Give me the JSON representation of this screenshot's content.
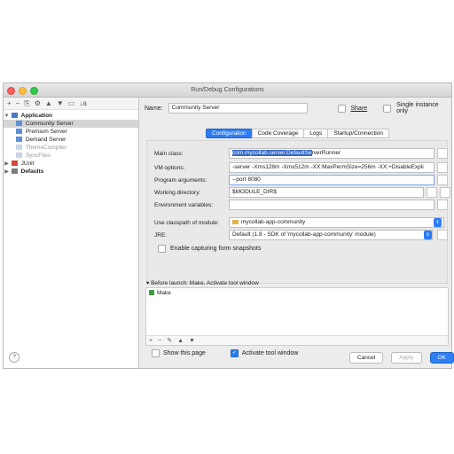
{
  "window": {
    "title": "Run/Debug Configurations"
  },
  "left_toolbar": {
    "add": "+",
    "remove": "−",
    "copy": "⎘",
    "settings": "⚙",
    "up": "▲",
    "down": "▼",
    "folder": "▭",
    "sort": "↓a"
  },
  "tree": {
    "application": "Application",
    "items": [
      "Community Server",
      "Premium Server",
      "Demand Server",
      "ThemeCompiler",
      "SyncFiles"
    ],
    "junit": "JUnit",
    "defaults": "Defaults"
  },
  "name_row": {
    "label": "Name:",
    "value": "Community Server",
    "share": "Share",
    "single": "Single instance only"
  },
  "tabs": [
    "Configuration",
    "Code Coverage",
    "Logs",
    "Startup/Connection"
  ],
  "form": {
    "main_class_label": "Main class:",
    "main_class_prefix": "com.mycollab.server.DefaultSe",
    "main_class_suffix": "rverRunner",
    "vm_label": "VM options:",
    "vm_value": "-server -Xms128m -Xmx512m -XX:MaxPermSize=256m -XX:+DisableExpli",
    "prog_label": "Program arguments:",
    "prog_value": "--port 8080",
    "wd_label": "Working directory:",
    "wd_value": "$MODULE_DIR$",
    "env_label": "Environment variables:",
    "env_value": "",
    "cp_label": "Use classpath of module:",
    "cp_value": "mycollab-app-community",
    "jre_label": "JRE:",
    "jre_value": "Default (1.8 - SDK of 'mycollab-app-community' module)",
    "snap_label": "Enable capturing form snapshots"
  },
  "before": {
    "title": "▾ Before launch: Make, Activate tool window",
    "item": "Make",
    "toolbar": [
      "+",
      "−",
      "✎",
      "▲",
      "▼"
    ]
  },
  "bottom": {
    "show_page": "Show this page",
    "activate": "Activate tool window",
    "help": "?"
  },
  "buttons": {
    "cancel": "Cancel",
    "apply": "Apply",
    "ok": "OK"
  }
}
